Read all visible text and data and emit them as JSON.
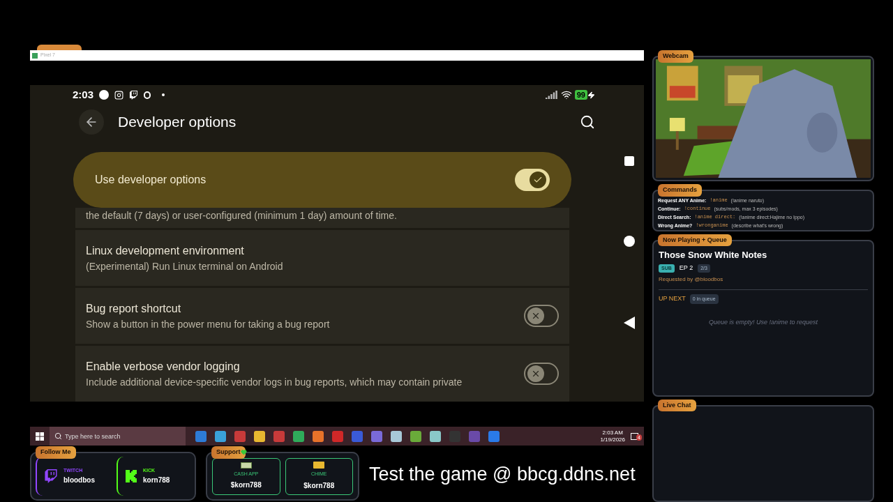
{
  "window": {
    "title": "Pixel 7"
  },
  "phone": {
    "time": "2:03",
    "battery": "99",
    "title": "Developer options",
    "main_switch": {
      "label": "Use developer options",
      "on": true
    },
    "settings": [
      {
        "kind": "text",
        "subtitle": "the default (7 days) or user-configured (minimum 1 day) amount of time."
      },
      {
        "kind": "text",
        "title": "Linux development environment",
        "subtitle": "(Experimental) Run Linux terminal on Android"
      },
      {
        "kind": "switch",
        "title": "Bug report shortcut",
        "subtitle": "Show a button in the power menu for taking a bug report",
        "on": false
      },
      {
        "kind": "switch",
        "title": "Enable verbose vendor logging",
        "subtitle": "Include additional device-specific vendor logs in bug reports, which may contain private",
        "on": false
      }
    ]
  },
  "taskbar": {
    "search_placeholder": "Type here to search",
    "time": "2:03 AM",
    "date": "1/19/2026",
    "notification_count": "4"
  },
  "follow": {
    "label": "Follow Me",
    "links": [
      {
        "kind": "twitch",
        "platform": "TWITCH",
        "handle": "bloodbos",
        "color": "#9146ff"
      },
      {
        "kind": "kick",
        "platform": "KICK",
        "handle": "korn788",
        "color": "#53fc18"
      }
    ]
  },
  "support": {
    "label": "Support",
    "methods": [
      {
        "kind": "cash",
        "name": "CASH APP",
        "handle": "$korn788"
      },
      {
        "kind": "card",
        "name": "CHIME",
        "handle": "$korn788"
      }
    ]
  },
  "banner": "Test the game @ bbcg.ddns.net",
  "webcam": {
    "label": "Webcam"
  },
  "commands": {
    "label": "Commands",
    "items": [
      {
        "name": "Request ANY Anime:",
        "command": "!anime",
        "example": "(!anime naruto)"
      },
      {
        "name": "Continue:",
        "command": "!continue",
        "example": "(subs/mods, max 3 episodes)"
      },
      {
        "name": "Direct Search:",
        "command": "!anime direct:",
        "example": "(!anime direct:Hajime no Ippo)"
      },
      {
        "name": "Wrong Anime?",
        "command": "!wronganime",
        "example": "(describe what's wrong)"
      }
    ]
  },
  "now_playing": {
    "label": "Now Playing + Queue",
    "title": "Those Snow White Notes",
    "badge": "SUB",
    "episode": "EP 2",
    "progress": "2/3",
    "requested_by": "Requested by @bloodbos",
    "up_next": "UP NEXT",
    "queue_count": "0 in queue",
    "empty": "Queue is empty! Use !anime to request"
  },
  "chat": {
    "label": "Live Chat"
  }
}
